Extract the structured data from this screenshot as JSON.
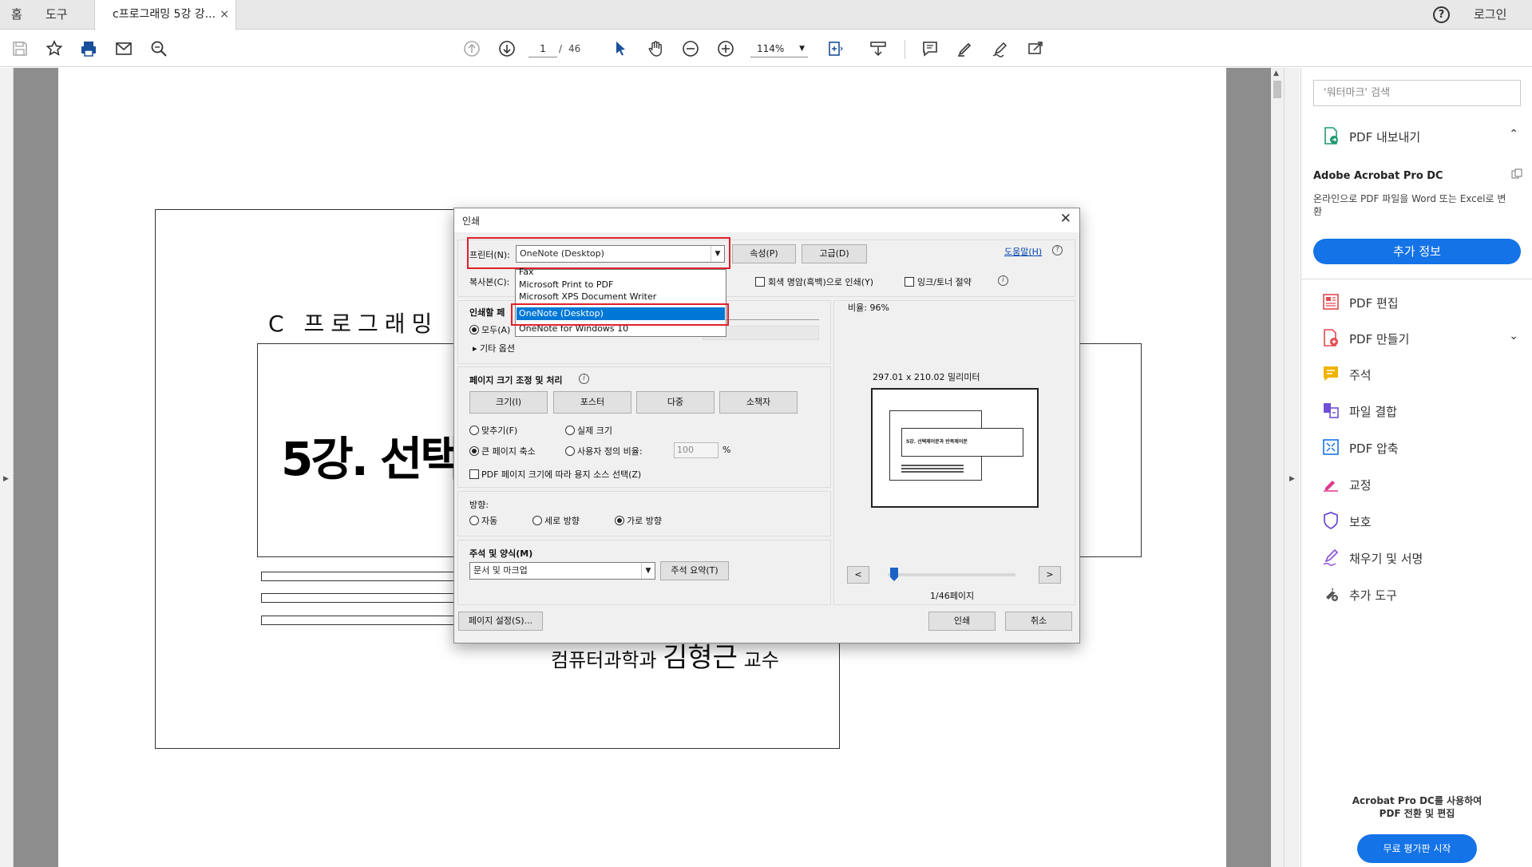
{
  "tabs": {
    "home": "홈",
    "tools": "도구",
    "document": "c프로그래밍 5강 강...",
    "close": "×"
  },
  "header": {
    "help": "?",
    "login": "로그인"
  },
  "toolbar": {
    "page_current": "1",
    "page_separator": "/",
    "page_total": "46",
    "zoom": "114%"
  },
  "slide": {
    "title": "C 프로그래밍",
    "heading": "5강. 선택",
    "author_prefix": "컴퓨터과학과",
    "author_name": "김형근",
    "author_suffix": "교수"
  },
  "sidebar": {
    "search_placeholder": "'워터마크' 검색",
    "export_label": "PDF 내보내기",
    "product_name": "Adobe Acrobat Pro DC",
    "product_desc": "온라인으로 PDF 파일을 Word 또는 Excel로 변환",
    "more_info": "추가 정보",
    "items": [
      {
        "label": "PDF 편집",
        "icon": "edit-pdf-icon",
        "color": "#e34850"
      },
      {
        "label": "PDF 만들기",
        "icon": "create-pdf-icon",
        "color": "#e34850"
      },
      {
        "label": "주석",
        "icon": "comment-icon",
        "color": "#f0b400"
      },
      {
        "label": "파일 결합",
        "icon": "combine-files-icon",
        "color": "#6e4fd6"
      },
      {
        "label": "PDF 압축",
        "icon": "compress-pdf-icon",
        "color": "#1473e6"
      },
      {
        "label": "교정",
        "icon": "redact-icon",
        "color": "#e0368c"
      },
      {
        "label": "보호",
        "icon": "protect-icon",
        "color": "#6e4fd6"
      },
      {
        "label": "채우기 및 서명",
        "icon": "fill-sign-icon",
        "color": "#8a4fd6"
      },
      {
        "label": "추가 도구",
        "icon": "more-tools-icon",
        "color": "#555555"
      }
    ],
    "bottom_text_1": "Acrobat Pro DC를 사용하여",
    "bottom_text_2": "PDF 전환 및 편집",
    "trial_button": "무료 평가판 시작"
  },
  "print_dialog": {
    "title": "인쇄",
    "printer_label": "프린터(N):",
    "printer_value": "OneNote (Desktop)",
    "properties_button": "속성(P)",
    "advanced_button": "고급(D)",
    "help_link": "도움말(H)",
    "copies_label": "복사본(C):",
    "grayscale_label": "회색 명암(흑백)으로 인쇄(Y)",
    "save_ink_label": "잉크/토너 절약",
    "printer_options": [
      "Fax",
      "Microsoft Print to PDF",
      "Microsoft XPS Document Writer",
      "OneNote (Desktop)",
      "OneNote for Windows 10"
    ],
    "selected_printer_index": 3,
    "pages_section_label": "인쇄할 페",
    "pages_all": "모두(A)",
    "more_options": "기타 옵션",
    "scale_label": "비율: 96%",
    "paper_size": "297.01 x 210.02 밀리미터",
    "sizing_section": "페이지 크기 조정 및 처리",
    "size_btn": "크기(I)",
    "poster_btn": "포스터",
    "multiple_btn": "다중",
    "booklet_btn": "소책자",
    "fit": "맞추기(F)",
    "actual_size": "실제 크기",
    "shrink": "큰 페이지 축소",
    "custom_scale": "사용자 정의 비율:",
    "custom_scale_value": "100",
    "percent": "%",
    "paper_source": "PDF 페이지 크기에 따라 용지 소스 선택(Z)",
    "orientation_label": "방향:",
    "auto": "자동",
    "portrait": "세로 방향",
    "landscape": "가로 방향",
    "comments_label": "주석 및 양식(M)",
    "comments_value": "문서 및 마크업",
    "summarize_btn": "주석 요약(T)",
    "page_setup_btn": "페이지 설정(S)...",
    "print_btn": "인쇄",
    "cancel_btn": "취소",
    "preview_page": "1/46페이지",
    "preview_heading": "5강. 선택제어문과 반복제어문",
    "prev": "<",
    "next": ">"
  }
}
